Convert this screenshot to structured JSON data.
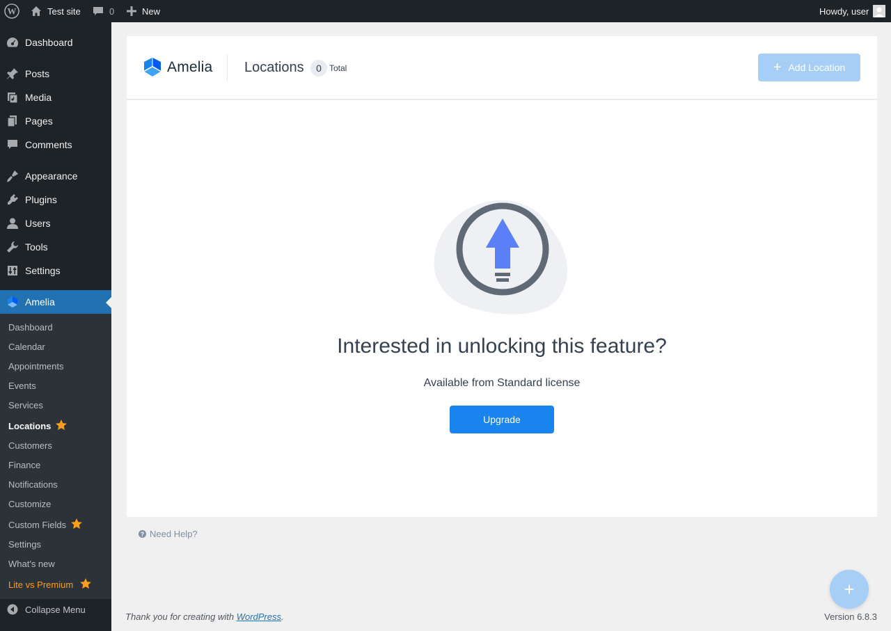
{
  "adminbar": {
    "site_name": "Test site",
    "comments_count": "0",
    "new_label": "New",
    "howdy": "Howdy, user"
  },
  "sidebar": {
    "items": [
      {
        "label": "Dashboard",
        "icon": "dashboard-icon"
      },
      {
        "label": "Posts",
        "icon": "pin-icon"
      },
      {
        "label": "Media",
        "icon": "media-icon"
      },
      {
        "label": "Pages",
        "icon": "pages-icon"
      },
      {
        "label": "Comments",
        "icon": "comment-icon"
      },
      {
        "label": "Appearance",
        "icon": "brush-icon"
      },
      {
        "label": "Plugins",
        "icon": "plugin-icon"
      },
      {
        "label": "Users",
        "icon": "user-icon"
      },
      {
        "label": "Tools",
        "icon": "wrench-icon"
      },
      {
        "label": "Settings",
        "icon": "settings-icon"
      },
      {
        "label": "Amelia",
        "icon": "amelia-icon"
      }
    ],
    "submenu": [
      {
        "label": "Dashboard"
      },
      {
        "label": "Calendar"
      },
      {
        "label": "Appointments"
      },
      {
        "label": "Events"
      },
      {
        "label": "Services"
      },
      {
        "label": "Locations"
      },
      {
        "label": "Customers"
      },
      {
        "label": "Finance"
      },
      {
        "label": "Notifications"
      },
      {
        "label": "Customize"
      },
      {
        "label": "Custom Fields"
      },
      {
        "label": "Settings"
      },
      {
        "label": "What's new"
      },
      {
        "label": "Lite vs Premium"
      }
    ],
    "collapse_label": "Collapse Menu"
  },
  "header": {
    "logo_text": "Amelia",
    "title": "Locations",
    "count": "0",
    "count_label": "Total",
    "add_button": "Add Location"
  },
  "content": {
    "title": "Interested in unlocking this feature?",
    "subtitle": "Available from Standard license",
    "upgrade_button": "Upgrade"
  },
  "help": {
    "label": "Need Help?"
  },
  "footer": {
    "thanks_prefix": "Thank you for creating with ",
    "wordpress_link": "WordPress",
    "thanks_suffix": ".",
    "version": "Version 6.8.3"
  },
  "colors": {
    "accent": "#2271b1",
    "amelia_blue": "#1a84ee",
    "star_orange": "#ff9e1b",
    "arrow_blue": "#5b7ff7"
  }
}
